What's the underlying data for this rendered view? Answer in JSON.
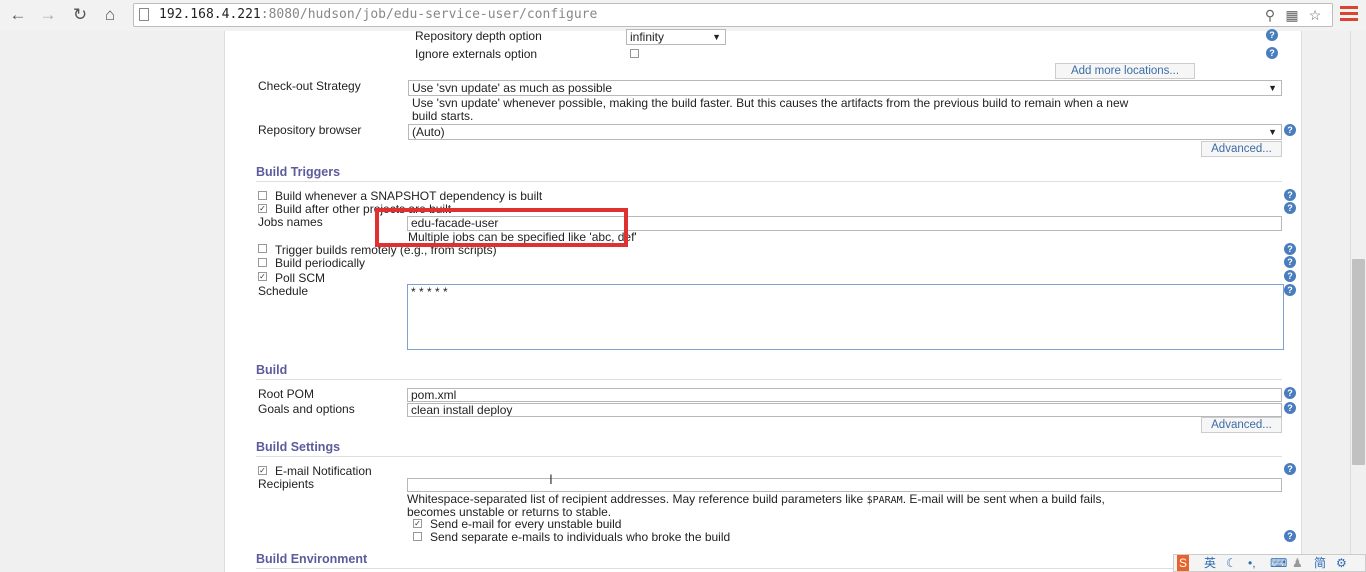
{
  "browser": {
    "url_host": "192.168.4.221",
    "url_rest": ":8080/hudson/job/edu-service-user/configure"
  },
  "scm": {
    "repo_depth_label": "Repository depth option",
    "repo_depth_value": "infinity",
    "ignore_externals_label": "Ignore externals option",
    "add_more_locations": "Add more locations...",
    "checkout_strategy_label": "Check-out Strategy",
    "checkout_strategy_value": "Use 'svn update' as much as possible",
    "checkout_strategy_desc_1": "Use 'svn update' whenever possible, making the build faster. But this causes the artifacts from the previous build to remain when a new",
    "checkout_strategy_desc_2": "build starts.",
    "repo_browser_label": "Repository browser",
    "repo_browser_value": "(Auto)",
    "advanced": "Advanced..."
  },
  "build_triggers": {
    "title": "Build Triggers",
    "snapshot_label": "Build whenever a SNAPSHOT dependency is built",
    "snapshot_checked": false,
    "after_other_label": "Build after other projects are built",
    "after_other_checked": true,
    "jobs_names_label": "Jobs names",
    "jobs_names_value": "edu-facade-user",
    "jobs_names_hint": "Multiple jobs can be specified like 'abc, def'",
    "remote_label": "Trigger builds remotely (e.g., from scripts)",
    "remote_checked": false,
    "periodic_label": "Build periodically",
    "periodic_checked": false,
    "poll_scm_label": "Poll SCM",
    "poll_scm_checked": true,
    "schedule_label": "Schedule",
    "schedule_value": "* * * * *"
  },
  "build": {
    "title": "Build",
    "root_pom_label": "Root POM",
    "root_pom_value": "pom.xml",
    "goals_label": "Goals and options",
    "goals_value": "clean install deploy",
    "advanced": "Advanced..."
  },
  "build_settings": {
    "title": "Build Settings",
    "email_label": "E-mail Notification",
    "email_checked": true,
    "recipients_label": "Recipients",
    "recipients_value": "",
    "recipients_desc_1": "Whitespace-separated list of recipient addresses. May reference build parameters like",
    "recipients_desc_param": "$PARAM",
    "recipients_desc_2": ". E-mail will be sent when a build fails,",
    "recipients_desc_3": "becomes unstable or returns to stable.",
    "unstable_label": "Send e-mail for every unstable build",
    "unstable_checked": true,
    "separate_label": "Send separate e-mails to individuals who broke the build",
    "separate_checked": false
  },
  "build_environment": {
    "title": "Build Environment"
  },
  "ime": {
    "lang": "英",
    "simplified": "简"
  },
  "colors": {
    "section_title": "#5c5c9c",
    "help_icon": "#4a7dbd",
    "highlight": "#e03030"
  }
}
